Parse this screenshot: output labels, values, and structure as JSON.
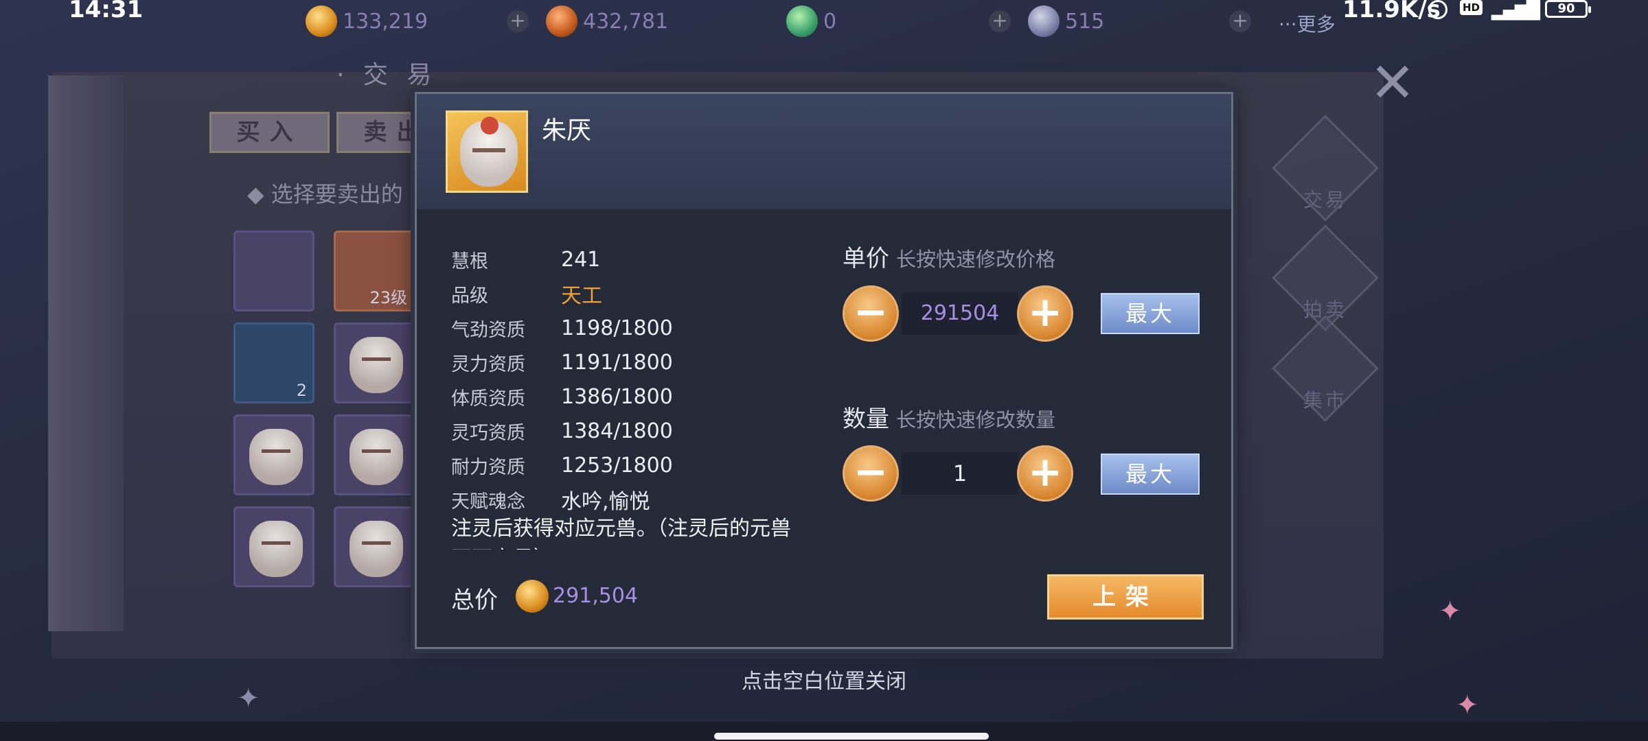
{
  "status": {
    "time": "14:31",
    "net_speed": "11.9K/s",
    "hd": "HD",
    "signal": "4G",
    "battery": "90"
  },
  "currencies": [
    {
      "icon": "gold-coin-icon",
      "amount": "133,219"
    },
    {
      "icon": "copper-coin-icon",
      "amount": "432,781"
    },
    {
      "icon": "jade-icon",
      "amount": "0"
    },
    {
      "icon": "stone-icon",
      "amount": "515"
    }
  ],
  "more_label": "···更多",
  "background": {
    "title": "· 交 易",
    "tabs": {
      "buy": "买入",
      "sell": "卖出"
    },
    "hint": "选择要卖出的",
    "slot_counts": {
      "vase": "23级",
      "orb": "2"
    },
    "nav": {
      "trade": "交易",
      "auction": "拍卖",
      "market": "集市"
    }
  },
  "dialog": {
    "pet_name": "朱厌",
    "stats": [
      {
        "label": "慧根",
        "value": "241"
      },
      {
        "label": "品级",
        "value": "天工"
      },
      {
        "label": "气劲资质",
        "value": "1198/1800"
      },
      {
        "label": "灵力资质",
        "value": "1191/1800"
      },
      {
        "label": "体质资质",
        "value": "1386/1800"
      },
      {
        "label": "灵巧资质",
        "value": "1384/1800"
      },
      {
        "label": "耐力资质",
        "value": "1253/1800"
      },
      {
        "label": "天赋魂念",
        "value": "水吟,愉悦"
      }
    ],
    "description": "注灵后获得对应元兽。（注灵后的元兽不可交易）",
    "price": {
      "label": "单价",
      "hint": "长按快速修改价格",
      "value": "291504",
      "max_label": "最大"
    },
    "quantity": {
      "label": "数量",
      "hint": "长按快速修改数量",
      "value": "1",
      "max_label": "最大"
    },
    "total": {
      "label": "总价",
      "value": "291,504"
    },
    "list_button": "上架"
  },
  "close_hint": "点击空白位置关闭",
  "colors": {
    "accent_orange": "#f0a033",
    "price_purple": "#a88fe6",
    "max_blue": "#8ea8dc"
  }
}
